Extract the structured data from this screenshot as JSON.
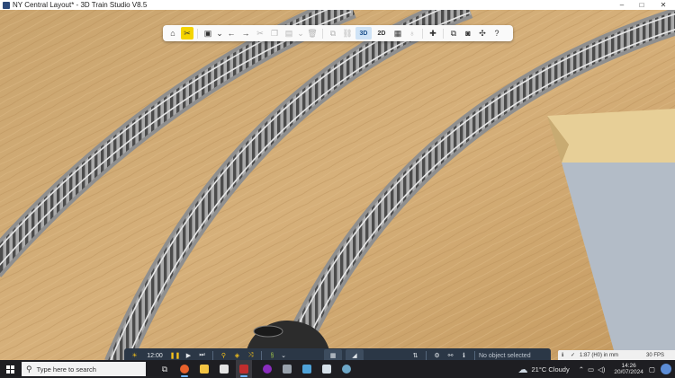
{
  "window": {
    "title": "NY Central Layout* - 3D Train Studio V8.5",
    "controls": [
      "–",
      "□",
      "✕"
    ]
  },
  "toolbar": {
    "view_3d": "3D",
    "view_2d": "2D",
    "help": "?",
    "accent": "#f4d400"
  },
  "bottombar": {
    "time": "12:00",
    "selection_status": "No object selected"
  },
  "statusbar": {
    "scale": "1:87 (H0) in mm",
    "fps": "30 FPS"
  },
  "taskbar": {
    "search_placeholder": "Type here to search",
    "weather": "21°C  Cloudy",
    "time": "14:26",
    "date": "20/07/2024"
  }
}
